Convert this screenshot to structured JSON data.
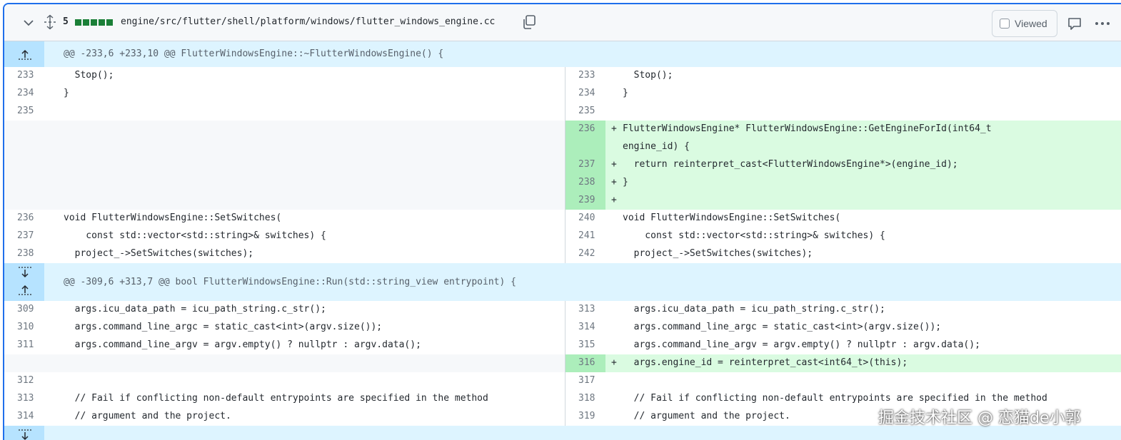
{
  "file_header": {
    "change_count": "5",
    "path": "engine/src/flutter/shell/platform/windows/flutter_windows_engine.cc",
    "viewed_label": "Viewed",
    "icons": [
      "chevron-down-icon",
      "unfold-icon",
      "copy-icon",
      "comment-icon",
      "kebab-horizontal-icon"
    ]
  },
  "hunks": [
    {
      "header": "@@ -233,6 +233,10 @@ FlutterWindowsEngine::~FlutterWindowsEngine() {"
    },
    {
      "header": "@@ -309,6 +313,7 @@ bool FlutterWindowsEngine::Run(std::string_view entrypoint) {"
    }
  ],
  "rows": [
    {
      "l_num": "233",
      "l_code": "  Stop();",
      "r_num": "233",
      "r_code": "  Stop();",
      "type": "context"
    },
    {
      "l_num": "234",
      "l_code": "}",
      "r_num": "234",
      "r_code": "}",
      "type": "context"
    },
    {
      "l_num": "235",
      "l_code": "",
      "r_num": "235",
      "r_code": "",
      "type": "context"
    },
    {
      "l_num": "",
      "l_code": "",
      "r_num": "236",
      "r_code": "FlutterWindowsEngine* FlutterWindowsEngine::GetEngineForId(int64_t",
      "type": "add"
    },
    {
      "l_num": "",
      "l_code": "",
      "r_num": "",
      "r_code": "engine_id) {",
      "type": "add-wrap"
    },
    {
      "l_num": "",
      "l_code": "",
      "r_num": "237",
      "r_code": "  return reinterpret_cast<FlutterWindowsEngine*>(engine_id);",
      "type": "add"
    },
    {
      "l_num": "",
      "l_code": "",
      "r_num": "238",
      "r_code": "}",
      "type": "add"
    },
    {
      "l_num": "",
      "l_code": "",
      "r_num": "239",
      "r_code": "",
      "type": "add"
    },
    {
      "l_num": "236",
      "l_code": "void FlutterWindowsEngine::SetSwitches(",
      "r_num": "240",
      "r_code": "void FlutterWindowsEngine::SetSwitches(",
      "type": "context"
    },
    {
      "l_num": "237",
      "l_code": "    const std::vector<std::string>& switches) {",
      "r_num": "241",
      "r_code": "    const std::vector<std::string>& switches) {",
      "type": "context"
    },
    {
      "l_num": "238",
      "l_code": "  project_->SetSwitches(switches);",
      "r_num": "242",
      "r_code": "  project_->SetSwitches(switches);",
      "type": "context"
    },
    {
      "l_num": "309",
      "l_code": "  args.icu_data_path = icu_path_string.c_str();",
      "r_num": "313",
      "r_code": "  args.icu_data_path = icu_path_string.c_str();",
      "type": "context"
    },
    {
      "l_num": "310",
      "l_code": "  args.command_line_argc = static_cast<int>(argv.size());",
      "r_num": "314",
      "r_code": "  args.command_line_argc = static_cast<int>(argv.size());",
      "type": "context"
    },
    {
      "l_num": "311",
      "l_code": "  args.command_line_argv = argv.empty() ? nullptr : argv.data();",
      "r_num": "315",
      "r_code": "  args.command_line_argv = argv.empty() ? nullptr : argv.data();",
      "type": "context"
    },
    {
      "l_num": "",
      "l_code": "",
      "r_num": "316",
      "r_code": "  args.engine_id = reinterpret_cast<int64_t>(this);",
      "type": "add"
    },
    {
      "l_num": "312",
      "l_code": "",
      "r_num": "317",
      "r_code": "",
      "type": "context"
    },
    {
      "l_num": "313",
      "l_code": "  // Fail if conflicting non-default entrypoints are specified in the method",
      "r_num": "318",
      "r_code": "  // Fail if conflicting non-default entrypoints are specified in the method",
      "type": "context"
    },
    {
      "l_num": "314",
      "l_code": "  // argument and the project.",
      "r_num": "319",
      "r_code": "  // argument and the project.",
      "type": "context"
    }
  ],
  "add_marker": "+",
  "watermark": "掘金技术社区 @ 恋猫de小郭",
  "colors": {
    "hunk_bg": "#ddf4ff",
    "hunk_gutter": "#b6e3ff",
    "add_bg": "#dafbe1",
    "add_gutter": "#aceebb",
    "focus_border": "#1f6feb",
    "stat_green": "#1a7f37"
  }
}
